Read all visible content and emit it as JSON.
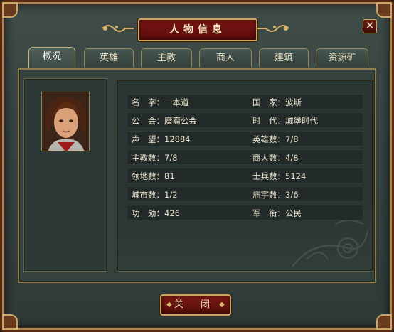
{
  "window": {
    "title": "人物信息",
    "close_icon_glyph": "✕",
    "close_button_label": "关 闭",
    "colors": {
      "title_plate": "#6a1010",
      "gold_trim": "#c9a763",
      "panel": "#34413d",
      "text": "#ece3cd"
    }
  },
  "tabs": [
    {
      "label": "概况",
      "active": true
    },
    {
      "label": "英雄",
      "active": false
    },
    {
      "label": "主教",
      "active": false
    },
    {
      "label": "商人",
      "active": false
    },
    {
      "label": "建筑",
      "active": false
    },
    {
      "label": "资源矿",
      "active": false
    }
  ],
  "portrait": {
    "icon": "hero-portrait-icon",
    "alt": "character portrait"
  },
  "info": {
    "rows": [
      {
        "left_label": "名　字：",
        "left_value": "一本道",
        "right_label": "国　家：",
        "right_value": "波斯"
      },
      {
        "left_label": "公　会：",
        "left_value": "魔裔公会",
        "right_label": "时　代：",
        "right_value": "城堡时代"
      },
      {
        "left_label": "声　望：",
        "left_value": "12884",
        "right_label": "英雄数：",
        "right_value": "7/8"
      },
      {
        "left_label": "主教数：",
        "left_value": "7/8",
        "right_label": "商人数：",
        "right_value": "4/8"
      },
      {
        "left_label": "领地数：",
        "left_value": "81",
        "right_label": "士兵数：",
        "right_value": "5124"
      },
      {
        "left_label": "城市数：",
        "left_value": "1/2",
        "right_label": "庙宇数：",
        "right_value": "3/6"
      },
      {
        "left_label": "功　勋：",
        "left_value": "426",
        "right_label": "军　衔：",
        "right_value": "公民"
      }
    ]
  }
}
